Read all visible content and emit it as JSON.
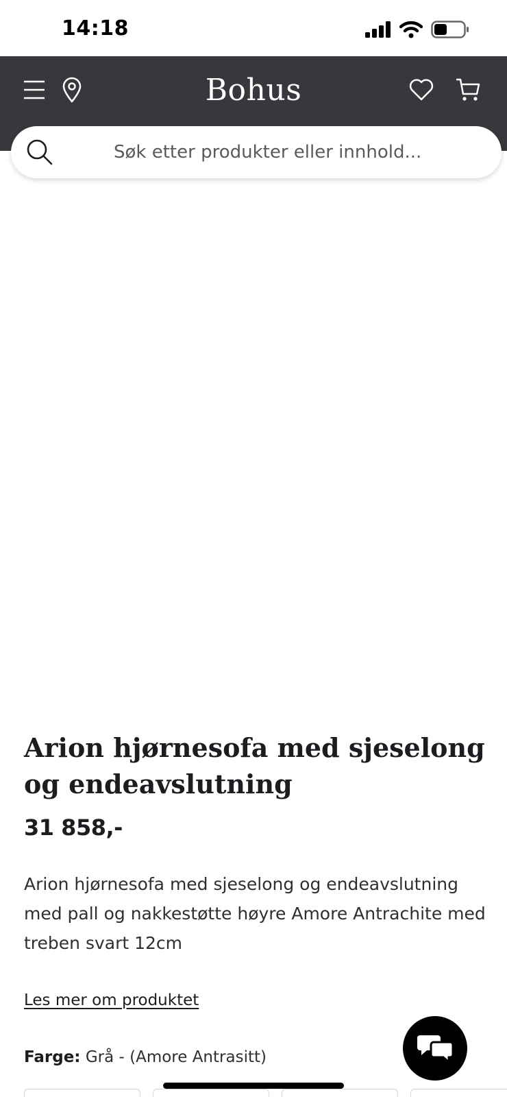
{
  "status_bar": {
    "time": "14:18"
  },
  "header": {
    "brand": "Bohus"
  },
  "search": {
    "placeholder": "Søk etter produkter eller innhold..."
  },
  "product": {
    "title": "Arion hjørnesofa med sjeselong og endeavslutning",
    "price": "31 858,-",
    "description": "Arion hjørnesofa med sjeselong og endeavslutning med pall og nakkestøtte høyre Amore Antrachite med treben svart 12cm",
    "read_more": "Les mer om produktet",
    "color_label": "Farge:",
    "color_value": "Grå - (Amore Antrasitt)"
  },
  "colors": {
    "header_bg": "#38383c",
    "gallery_bg": "#f4f3f2",
    "sofa": "#5a5760",
    "text": "#1c1d21"
  },
  "icons": [
    "signal-icon",
    "wifi-icon",
    "battery-icon",
    "menu-icon",
    "location-pin-icon",
    "heart-icon",
    "cart-icon",
    "search-icon",
    "zoom-in-icon",
    "chat-icon"
  ]
}
